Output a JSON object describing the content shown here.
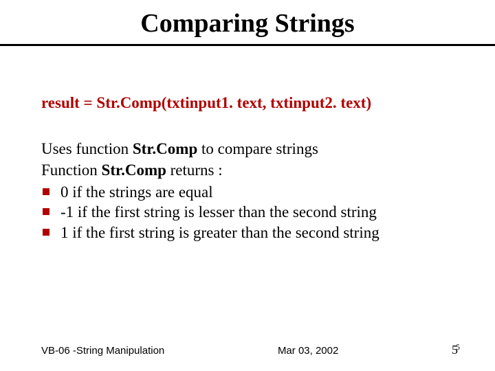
{
  "title": "Comparing Strings",
  "code_line": "result = Str.Comp(txtinput1. text, txtinput2. text)",
  "para1_pre": "Uses function ",
  "para1_bold": "Str.Comp",
  "para1_post": " to compare strings",
  "para2_pre": "Function ",
  "para2_bold": "Str.Comp",
  "para2_post": " returns :",
  "bullets": [
    "0 if the strings are equal",
    "-1 if the first string is lesser than  the second string",
    "1 if the first string is greater than the second string"
  ],
  "footer": {
    "left": "VB-06 -String Manipulation",
    "center": "Mar 03, 2002",
    "page_main": "5",
    "page_sup": "5"
  }
}
